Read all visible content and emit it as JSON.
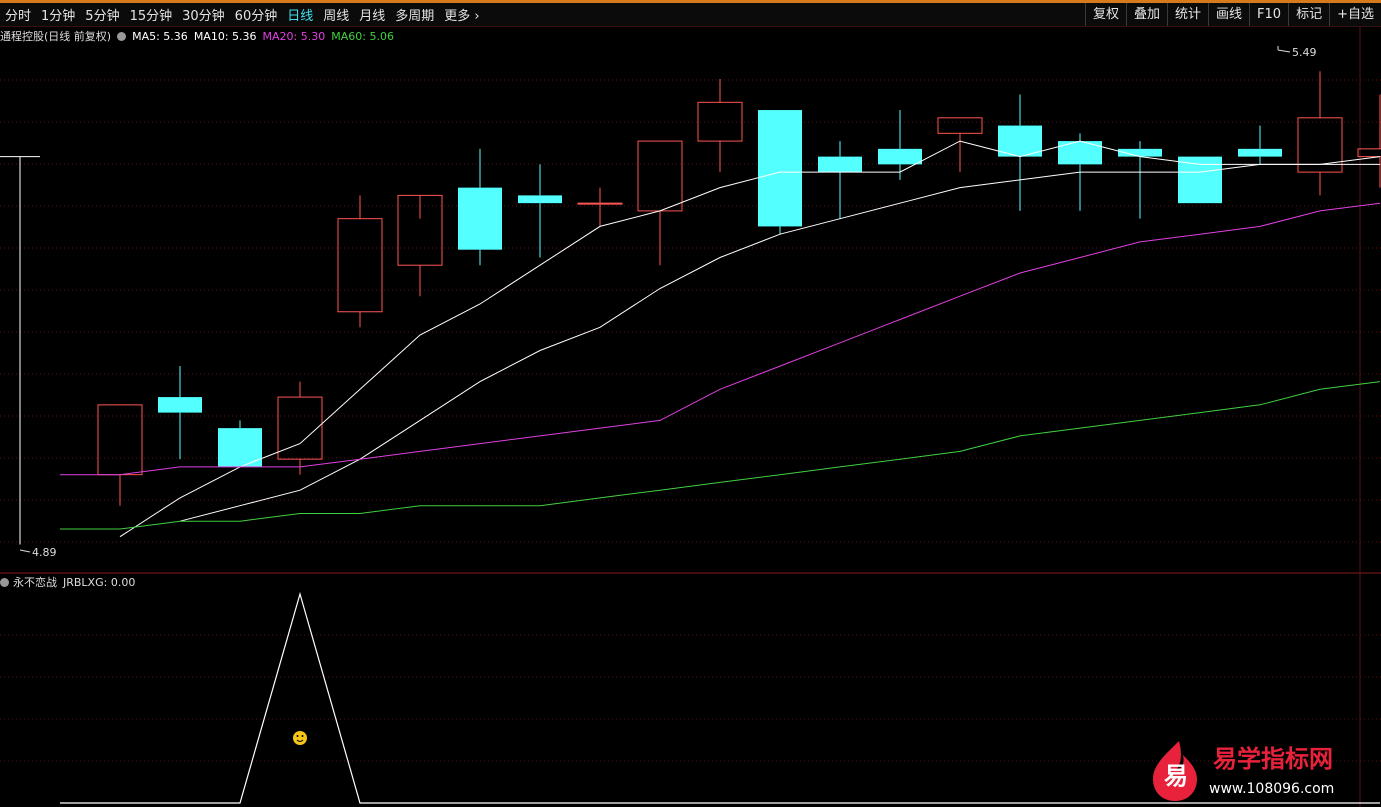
{
  "toolbar": {
    "periods": [
      "分时",
      "1分钟",
      "5分钟",
      "15分钟",
      "30分钟",
      "60分钟",
      "日线",
      "周线",
      "月线",
      "多周期",
      "更多"
    ],
    "active_period": "日线",
    "tools": [
      "复权",
      "叠加",
      "统计",
      "画线",
      "F10",
      "标记",
      "+自选"
    ]
  },
  "legend": {
    "stock_title": "通程控股(日线 前复权)",
    "ma5": "MA5: 5.36",
    "ma10": "MA10: 5.36",
    "ma20": "MA20: 5.30",
    "ma60": "MA60: 5.06",
    "colors": {
      "ma5": "#ffffff",
      "ma10": "#ffffff",
      "ma20": "#e040e0",
      "ma60": "#40d040"
    }
  },
  "sub_panel": {
    "indicator_name": "永不恋战",
    "value_label": "JRBLXG: 0.00"
  },
  "price_labels": {
    "high": "5.49",
    "low": "4.89"
  },
  "watermark": {
    "brand": "易学指标网",
    "url": "www.108096.com",
    "glyph": "易"
  },
  "colors": {
    "up": "#ff5555",
    "down": "#54ffff",
    "grid": "#5a1414",
    "signal": "#ffffff"
  },
  "chart_data": [
    {
      "type": "candlestick",
      "title": "通程控股(日线 前复权)",
      "ylim": [
        4.86,
        5.52
      ],
      "candles": [
        {
          "o": 5.38,
          "h": 5.36,
          "l": 4.88,
          "c": 4.9,
          "note": "partial cross at left edge"
        },
        {
          "o": 4.97,
          "h": 5.06,
          "l": 4.93,
          "c": 5.06
        },
        {
          "o": 5.07,
          "h": 5.11,
          "l": 4.99,
          "c": 5.05
        },
        {
          "o": 5.03,
          "h": 5.04,
          "l": 4.98,
          "c": 4.98
        },
        {
          "o": 4.99,
          "h": 5.09,
          "l": 4.97,
          "c": 5.07
        },
        {
          "o": 5.18,
          "h": 5.33,
          "l": 5.16,
          "c": 5.3
        },
        {
          "o": 5.24,
          "h": 5.3,
          "l": 5.2,
          "c": 5.33
        },
        {
          "o": 5.34,
          "h": 5.39,
          "l": 5.24,
          "c": 5.26
        },
        {
          "o": 5.33,
          "h": 5.37,
          "l": 5.25,
          "c": 5.32
        },
        {
          "o": 5.32,
          "h": 5.34,
          "l": 5.29,
          "c": 5.32
        },
        {
          "o": 5.31,
          "h": 5.4,
          "l": 5.24,
          "c": 5.4
        },
        {
          "o": 5.4,
          "h": 5.48,
          "l": 5.36,
          "c": 5.45
        },
        {
          "o": 5.44,
          "h": 5.44,
          "l": 5.28,
          "c": 5.29
        },
        {
          "o": 5.38,
          "h": 5.4,
          "l": 5.3,
          "c": 5.36
        },
        {
          "o": 5.39,
          "h": 5.44,
          "l": 5.35,
          "c": 5.37
        },
        {
          "o": 5.41,
          "h": 5.43,
          "l": 5.36,
          "c": 5.43
        },
        {
          "o": 5.42,
          "h": 5.46,
          "l": 5.31,
          "c": 5.38
        },
        {
          "o": 5.4,
          "h": 5.41,
          "l": 5.31,
          "c": 5.37
        },
        {
          "o": 5.39,
          "h": 5.4,
          "l": 5.3,
          "c": 5.38
        },
        {
          "o": 5.38,
          "h": 5.38,
          "l": 5.34,
          "c": 5.32
        },
        {
          "o": 5.39,
          "h": 5.42,
          "l": 5.37,
          "c": 5.38
        },
        {
          "o": 5.36,
          "h": 5.49,
          "l": 5.33,
          "c": 5.43
        },
        {
          "o": 5.38,
          "h": 5.46,
          "l": 5.34,
          "c": 5.39
        }
      ],
      "series": [
        {
          "name": "MA5",
          "values": [
            null,
            4.89,
            4.94,
            4.98,
            5.01,
            5.08,
            5.15,
            5.19,
            5.24,
            5.29,
            5.31,
            5.34,
            5.36,
            5.36,
            5.36,
            5.4,
            5.38,
            5.4,
            5.38,
            5.37,
            5.37,
            5.37,
            5.37
          ]
        },
        {
          "name": "MA10",
          "values": [
            null,
            null,
            4.91,
            4.93,
            4.95,
            4.99,
            5.04,
            5.09,
            5.13,
            5.16,
            5.21,
            5.25,
            5.28,
            5.3,
            5.32,
            5.34,
            5.35,
            5.36,
            5.36,
            5.36,
            5.37,
            5.37,
            5.38
          ]
        },
        {
          "name": "MA20",
          "values": [
            4.97,
            4.97,
            4.98,
            4.98,
            4.98,
            4.99,
            5.0,
            5.01,
            5.02,
            5.03,
            5.04,
            5.08,
            5.11,
            5.14,
            5.17,
            5.2,
            5.23,
            5.25,
            5.27,
            5.28,
            5.29,
            5.31,
            5.32
          ]
        },
        {
          "name": "MA60",
          "values": [
            4.9,
            4.9,
            4.91,
            4.91,
            4.92,
            4.92,
            4.93,
            4.93,
            4.93,
            4.94,
            4.95,
            4.96,
            4.97,
            4.98,
            4.99,
            5.0,
            5.02,
            5.03,
            5.04,
            5.05,
            5.06,
            5.08,
            5.09
          ]
        }
      ]
    },
    {
      "type": "line",
      "title": "永不恋战",
      "series": [
        {
          "name": "JRBLXG",
          "values": [
            0,
            0,
            0,
            0,
            1,
            0,
            0,
            0,
            0,
            0,
            0,
            0,
            0,
            0,
            0,
            0,
            0,
            0,
            0,
            0,
            0,
            0,
            0
          ]
        }
      ],
      "ylim": [
        0,
        1
      ]
    }
  ]
}
